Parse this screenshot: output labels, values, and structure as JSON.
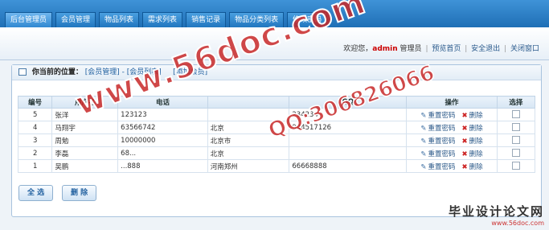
{
  "nav": {
    "tabs": [
      "后台管理员",
      "会员管理",
      "物品列表",
      "需求列表",
      "销售记录",
      "物品分类列表",
      "修改密码"
    ]
  },
  "status": {
    "welcome": "欢迎您，",
    "user": "admin",
    "role": "管理员",
    "links": [
      "预览首页",
      "安全退出",
      "关闭窗口"
    ]
  },
  "breadcrumb": {
    "label": "你当前的位置：",
    "path": "[会员管理] - [会员列表]",
    "add": "[添加会员]"
  },
  "table": {
    "headers": [
      "编号",
      "用户名",
      "电话",
      "",
      "QQ",
      "操作",
      "选择"
    ],
    "rows": [
      {
        "id": "5",
        "name": "张洋",
        "phone": "123123",
        "addr": "",
        "qq": "234234"
      },
      {
        "id": "4",
        "name": "马翔宇",
        "phone": "63566742",
        "addr": "北京",
        "qq": "944517126"
      },
      {
        "id": "3",
        "name": "周勉",
        "phone": "10000000",
        "addr": "北京市",
        "qq": ""
      },
      {
        "id": "2",
        "name": "李磊",
        "phone": "68...",
        "addr": "北京",
        "qq": ""
      },
      {
        "id": "1",
        "name": "吴鹏",
        "phone": "...888",
        "addr": "河南郑州",
        "qq": "66668888"
      }
    ],
    "reset_label": "重置密码",
    "delete_label": "删除"
  },
  "buttons": {
    "select_all": "全 选",
    "delete": "删 除"
  },
  "watermark": {
    "main": "www.56doc.com",
    "qq": "QQ:306826066",
    "logo_title": "毕业设计论文网",
    "logo_url": "www.56doc.com"
  }
}
